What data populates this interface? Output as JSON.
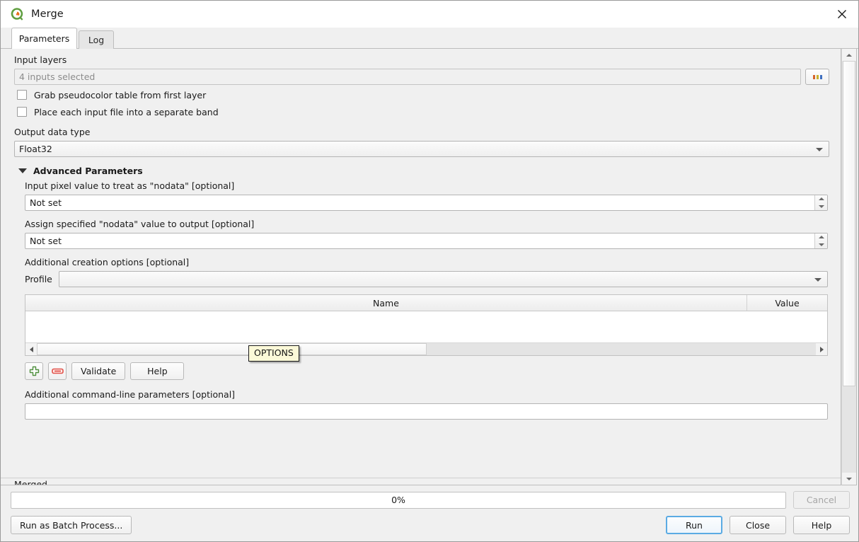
{
  "window": {
    "title": "Merge",
    "logo_icon": "qgis-logo-icon",
    "close_icon": "close-icon"
  },
  "tabs": [
    {
      "label": "Parameters",
      "selected": true
    },
    {
      "label": "Log",
      "selected": false
    }
  ],
  "form": {
    "input_layers": {
      "label": "Input layers",
      "value": "4 inputs selected",
      "browse_label": "...",
      "browse_icon": "ellipsis-dots-icon"
    },
    "checkboxes": [
      {
        "label": "Grab pseudocolor table from first layer",
        "checked": false
      },
      {
        "label": "Place each input file into a separate band",
        "checked": false
      }
    ],
    "output_data_type": {
      "label": "Output data type",
      "value": "Float32"
    },
    "advanced": {
      "label": "Advanced Parameters",
      "expanded": true,
      "toggle_icon": "triangle-down-icon",
      "input_nodata": {
        "label": "Input pixel value to treat as \"nodata\" [optional]",
        "value": "Not set"
      },
      "assign_nodata": {
        "label": "Assign specified \"nodata\" value to output [optional]",
        "value": "Not set"
      },
      "creation_options": {
        "label": "Additional creation options [optional]",
        "profile_label": "Profile",
        "profile_value": "",
        "dropdown_icon": "chevron-down-icon"
      },
      "options_table": {
        "columns": [
          "Name",
          "Value"
        ],
        "rows": []
      },
      "table_toolbar": {
        "add_icon": "plus-icon",
        "remove_icon": "minus-icon",
        "validate_label": "Validate",
        "help_label": "Help"
      },
      "command_line": {
        "label": "Additional command-line parameters [optional]",
        "value": ""
      }
    },
    "clipped_label": "Merged"
  },
  "footer": {
    "progress": {
      "text": "0%",
      "percent": 0
    },
    "cancel_label": "Cancel",
    "cancel_disabled": true,
    "batch_label": "Run as Batch Process...",
    "run_label": "Run",
    "close_label": "Close",
    "help_label": "Help"
  },
  "colors": {
    "tooltip_bg": "#fbf9d8",
    "focus_border": "#5babe3",
    "logo_green": "#5f9e3f",
    "logo_orange": "#e8721f",
    "plus_green": "#4f8f3e",
    "minus_red": "#e2524a"
  },
  "tooltip": {
    "text": "OPTIONS"
  }
}
